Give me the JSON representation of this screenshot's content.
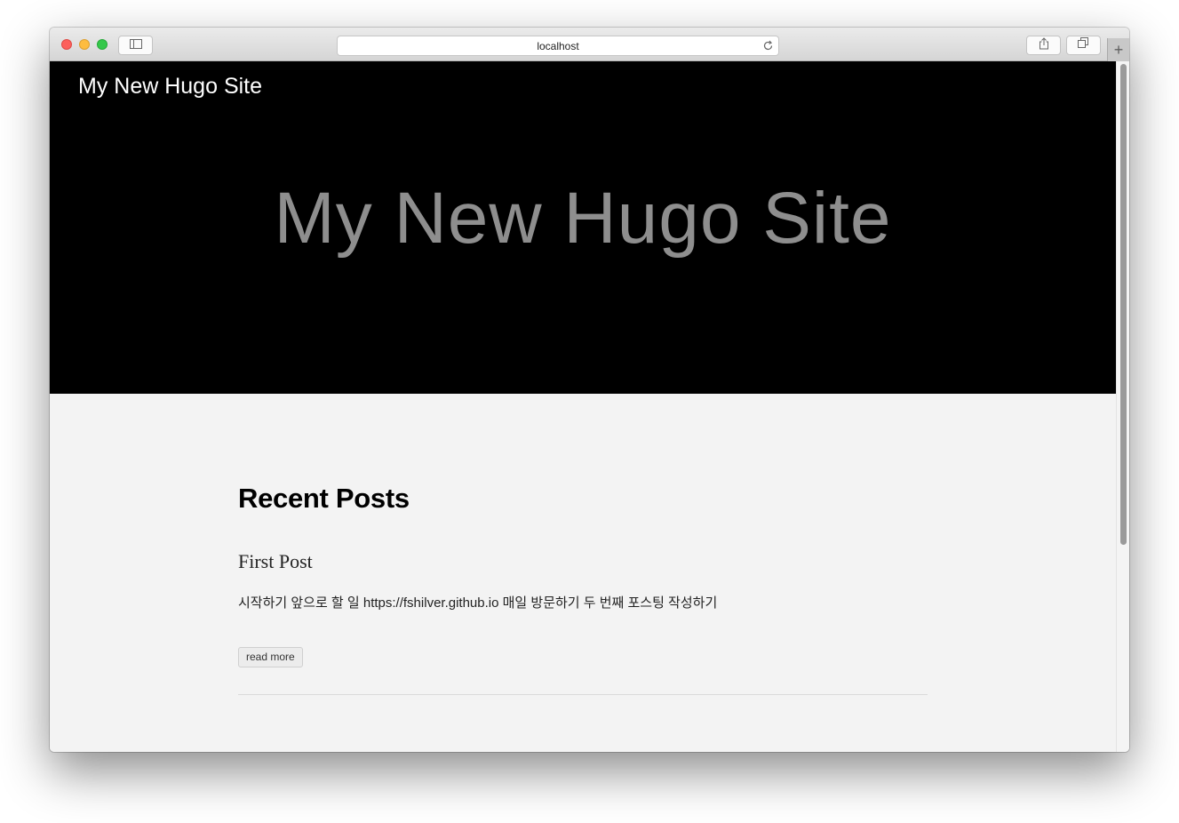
{
  "browser": {
    "url": "localhost",
    "new_tab_label": "+"
  },
  "page": {
    "nav_title": "My New Hugo Site",
    "hero_title": "My New Hugo Site",
    "section_title": "Recent Posts",
    "posts": [
      {
        "title": "First Post",
        "summary": "시작하기 앞으로 할 일 https://fshilver.github.io 매일 방문하기 두 번째 포스팅 작성하기",
        "read_more_label": "read more"
      }
    ]
  },
  "icons": {
    "sidebar": "sidebar-icon",
    "reload": "reload-icon",
    "share": "share-icon",
    "tabs": "tabs-overview-icon"
  },
  "colors": {
    "hero_background": "#000000",
    "content_background": "#f3f3f3",
    "hero_title": "#8e8e8e"
  }
}
